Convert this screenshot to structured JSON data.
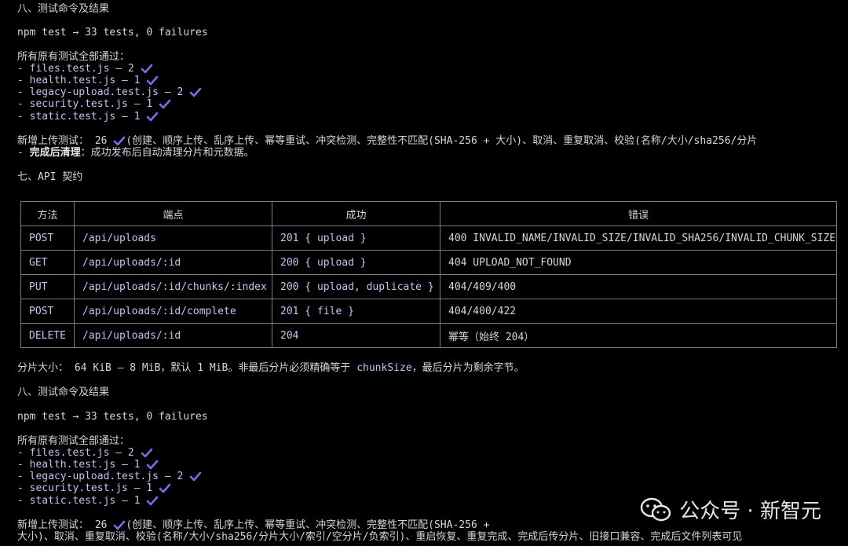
{
  "colors": {
    "accent": "#7b6ce8",
    "background": "#000000",
    "text": "#d6d6dc",
    "code": "#c4c4f4"
  },
  "section8_top": {
    "heading": "八、测试命令及结果",
    "cmd": "npm test → 33 tests, 0 failures",
    "passed_line": "所有原有测试全部通过：",
    "files": [
      "- files.test.js – 2",
      "- health.test.js – 1",
      "- legacy-upload.test.js – 2",
      "- security.test.js – 1",
      "- static.test.js – 1"
    ],
    "new_tests_label": "新增上传测试：",
    "new_tests_count": "26",
    "new_tests_desc": "(创建、顺序上传、乱序上传、幂等重试、冲突检测、完整性不匹配(SHA-256 + 大小)、取消、重复取消、校验(名称/大小/sha256/分片",
    "cleanup_prefix": "- ",
    "cleanup_label": "完成后清理",
    "cleanup_desc": "：成功发布后自动清理分片和元数据。"
  },
  "section7": {
    "heading": "七、API 契约",
    "table": {
      "headers": [
        "方法",
        "端点",
        "成功",
        "错误"
      ],
      "rows": [
        [
          "POST",
          "/api/uploads",
          "201 { upload }",
          "400 INVALID_NAME/INVALID_SIZE/INVALID_SHA256/INVALID_CHUNK_SIZE"
        ],
        [
          "GET",
          "/api/uploads/:id",
          "200 { upload }",
          "404 UPLOAD_NOT_FOUND"
        ],
        [
          "PUT",
          "/api/uploads/:id/chunks/:index",
          "200 { upload, duplicate }",
          "404/409/400"
        ],
        [
          "POST",
          "/api/uploads/:id/complete",
          "201 { file }",
          "404/400/422"
        ],
        [
          "DELETE",
          "/api/uploads/:id",
          "204",
          "幂等（始终 204）"
        ]
      ]
    },
    "chunk_prefix": "分片大小：",
    "chunk_range": " 64 KiB – 8 MiB，默认 1 MiB。非最后分片必须精确等于 ",
    "chunk_code": "chunkSize",
    "chunk_suffix": "，最后分片为剩余字节。"
  },
  "section8_bottom": {
    "heading": "八、测试命令及结果",
    "cmd": "npm test → 33 tests, 0 failures",
    "passed_line": "所有原有测试全部通过：",
    "files": [
      "- files.test.js – 2",
      "- health.test.js – 1",
      "- legacy-upload.test.js – 2",
      "- security.test.js – 1",
      "- static.test.js – 1"
    ],
    "new_tests_label": "新增上传测试：",
    "new_tests_count": "26",
    "new_tests_desc": "(创建、顺序上传、乱序上传、幂等重试、冲突检测、完整性不匹配(SHA-256 +",
    "new_tests_desc2": "大小)、取消、重复取消、校验(名称/大小/sha256/分片大小/索引/空分片/负索引)、重启恢复、重复完成、完成后传分片、旧接口兼容、完成后文件列表可见"
  },
  "watermark": {
    "text": "公众号 · 新智元",
    "icon": "wechat-icon"
  }
}
